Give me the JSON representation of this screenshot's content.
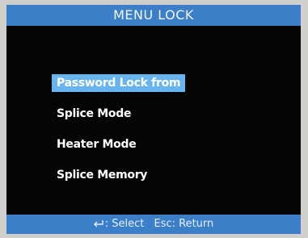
{
  "title": "MENU LOCK",
  "menu": {
    "items": [
      {
        "label": "Password Lock from",
        "selected": true
      },
      {
        "label": "Splice Mode",
        "selected": false
      },
      {
        "label": "Heater Mode",
        "selected": false
      },
      {
        "label": "Splice Memory",
        "selected": false
      }
    ]
  },
  "footer": {
    "select_icon": "enter-key-icon",
    "select_label": ": Select",
    "return_label": "Esc: Return"
  },
  "colors": {
    "bar": "#3b7fc8",
    "highlight": "#68b4ef",
    "screen_bg": "#050505",
    "text": "#ffffff"
  }
}
